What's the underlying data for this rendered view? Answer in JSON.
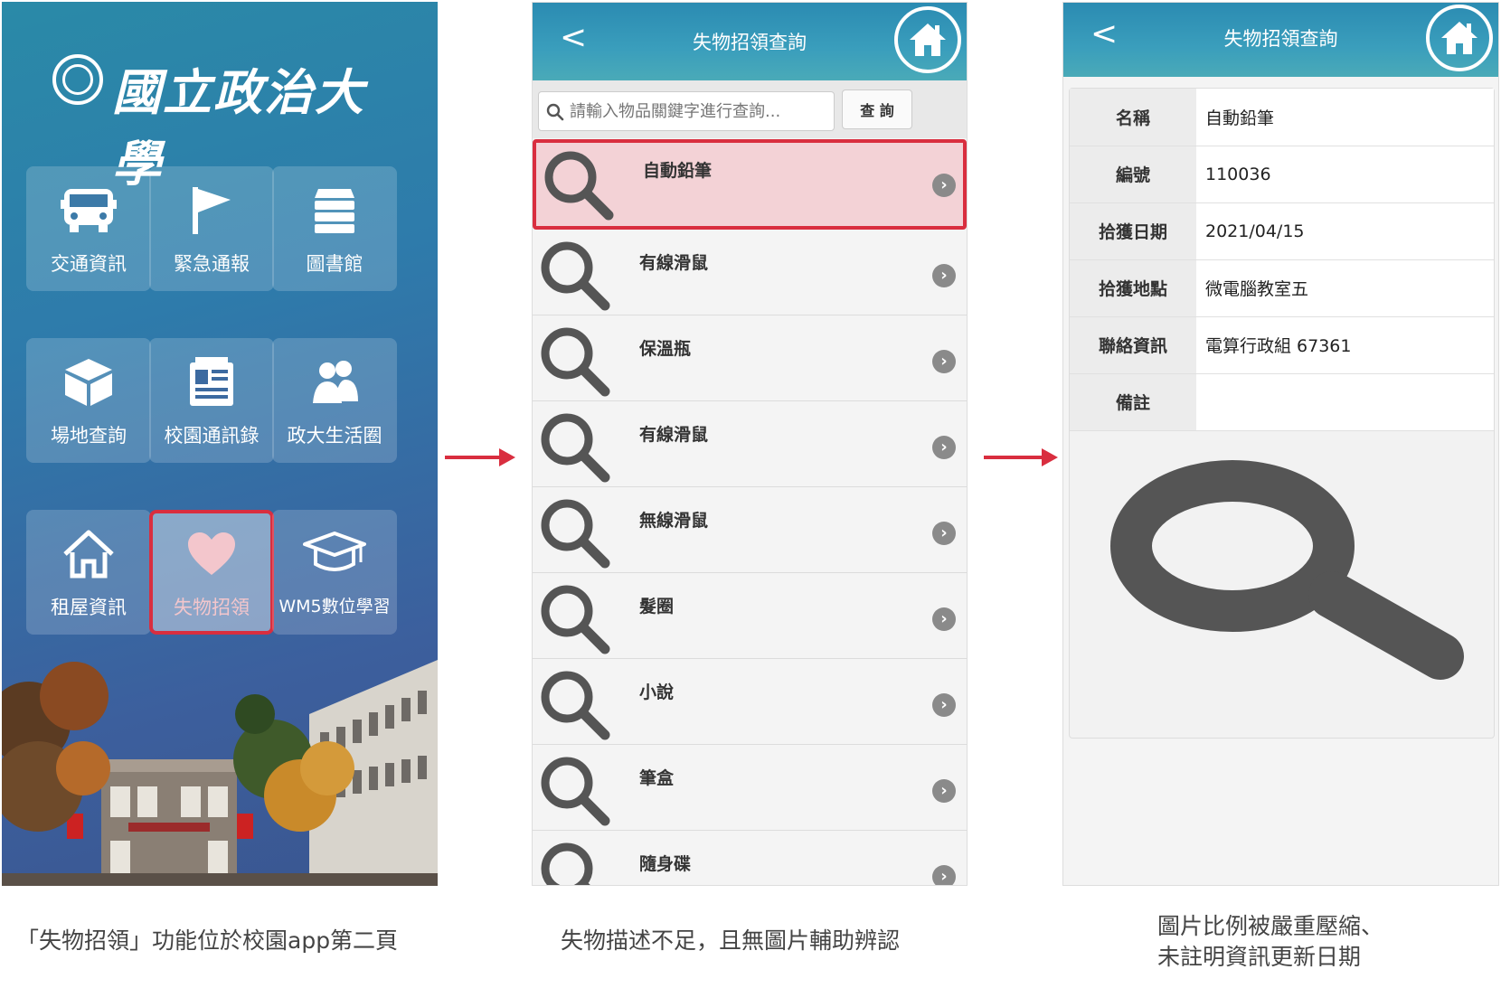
{
  "panel1": {
    "logo_text": "國立政治大學",
    "tiles": [
      {
        "label": "交通資訊",
        "icon": "bus-icon"
      },
      {
        "label": "緊急通報",
        "icon": "flag-icon"
      },
      {
        "label": "圖書館",
        "icon": "library-icon"
      },
      {
        "label": "場地查詢",
        "icon": "cube-icon"
      },
      {
        "label": "校園通訊錄",
        "icon": "contacts-icon"
      },
      {
        "label": "政大生活圈",
        "icon": "people-icon"
      },
      {
        "label": "租屋資訊",
        "icon": "house-icon"
      },
      {
        "label": "失物招領",
        "icon": "heart-icon"
      },
      {
        "label": "WM5數位學習",
        "icon": "graduation-cap-icon"
      }
    ]
  },
  "panel2": {
    "header_back": "<",
    "header_title": "失物招領查詢",
    "search_placeholder": "請輸入物品關鍵字進行查詢...",
    "search_button": "查 詢",
    "items": [
      "自動鉛筆",
      "有線滑鼠",
      "保溫瓶",
      "有線滑鼠",
      "無線滑鼠",
      "髮圈",
      "小說",
      "筆盒",
      "隨身碟"
    ]
  },
  "panel3": {
    "header_back": "<",
    "header_title": "失物招領查詢",
    "fields": [
      {
        "key": "名稱",
        "value": "自動鉛筆"
      },
      {
        "key": "編號",
        "value": "110036"
      },
      {
        "key": "拾獲日期",
        "value": "2021/04/15"
      },
      {
        "key": "拾獲地點",
        "value": "微電腦教室五"
      },
      {
        "key": "聯絡資訊",
        "value": "電算行政組 67361"
      },
      {
        "key": "備註",
        "value": ""
      }
    ]
  },
  "captions": {
    "c1": "「失物招領」功能位於校園app第二頁",
    "c2": "失物描述不足，且無圖片輔助辨認",
    "c3_line1": "圖片比例被嚴重壓縮、",
    "c3_line2": "未註明資訊更新日期"
  },
  "colors": {
    "accent_red": "#d92e3f",
    "header_teal": "#2b8bb2",
    "icon_gray": "#555555"
  }
}
